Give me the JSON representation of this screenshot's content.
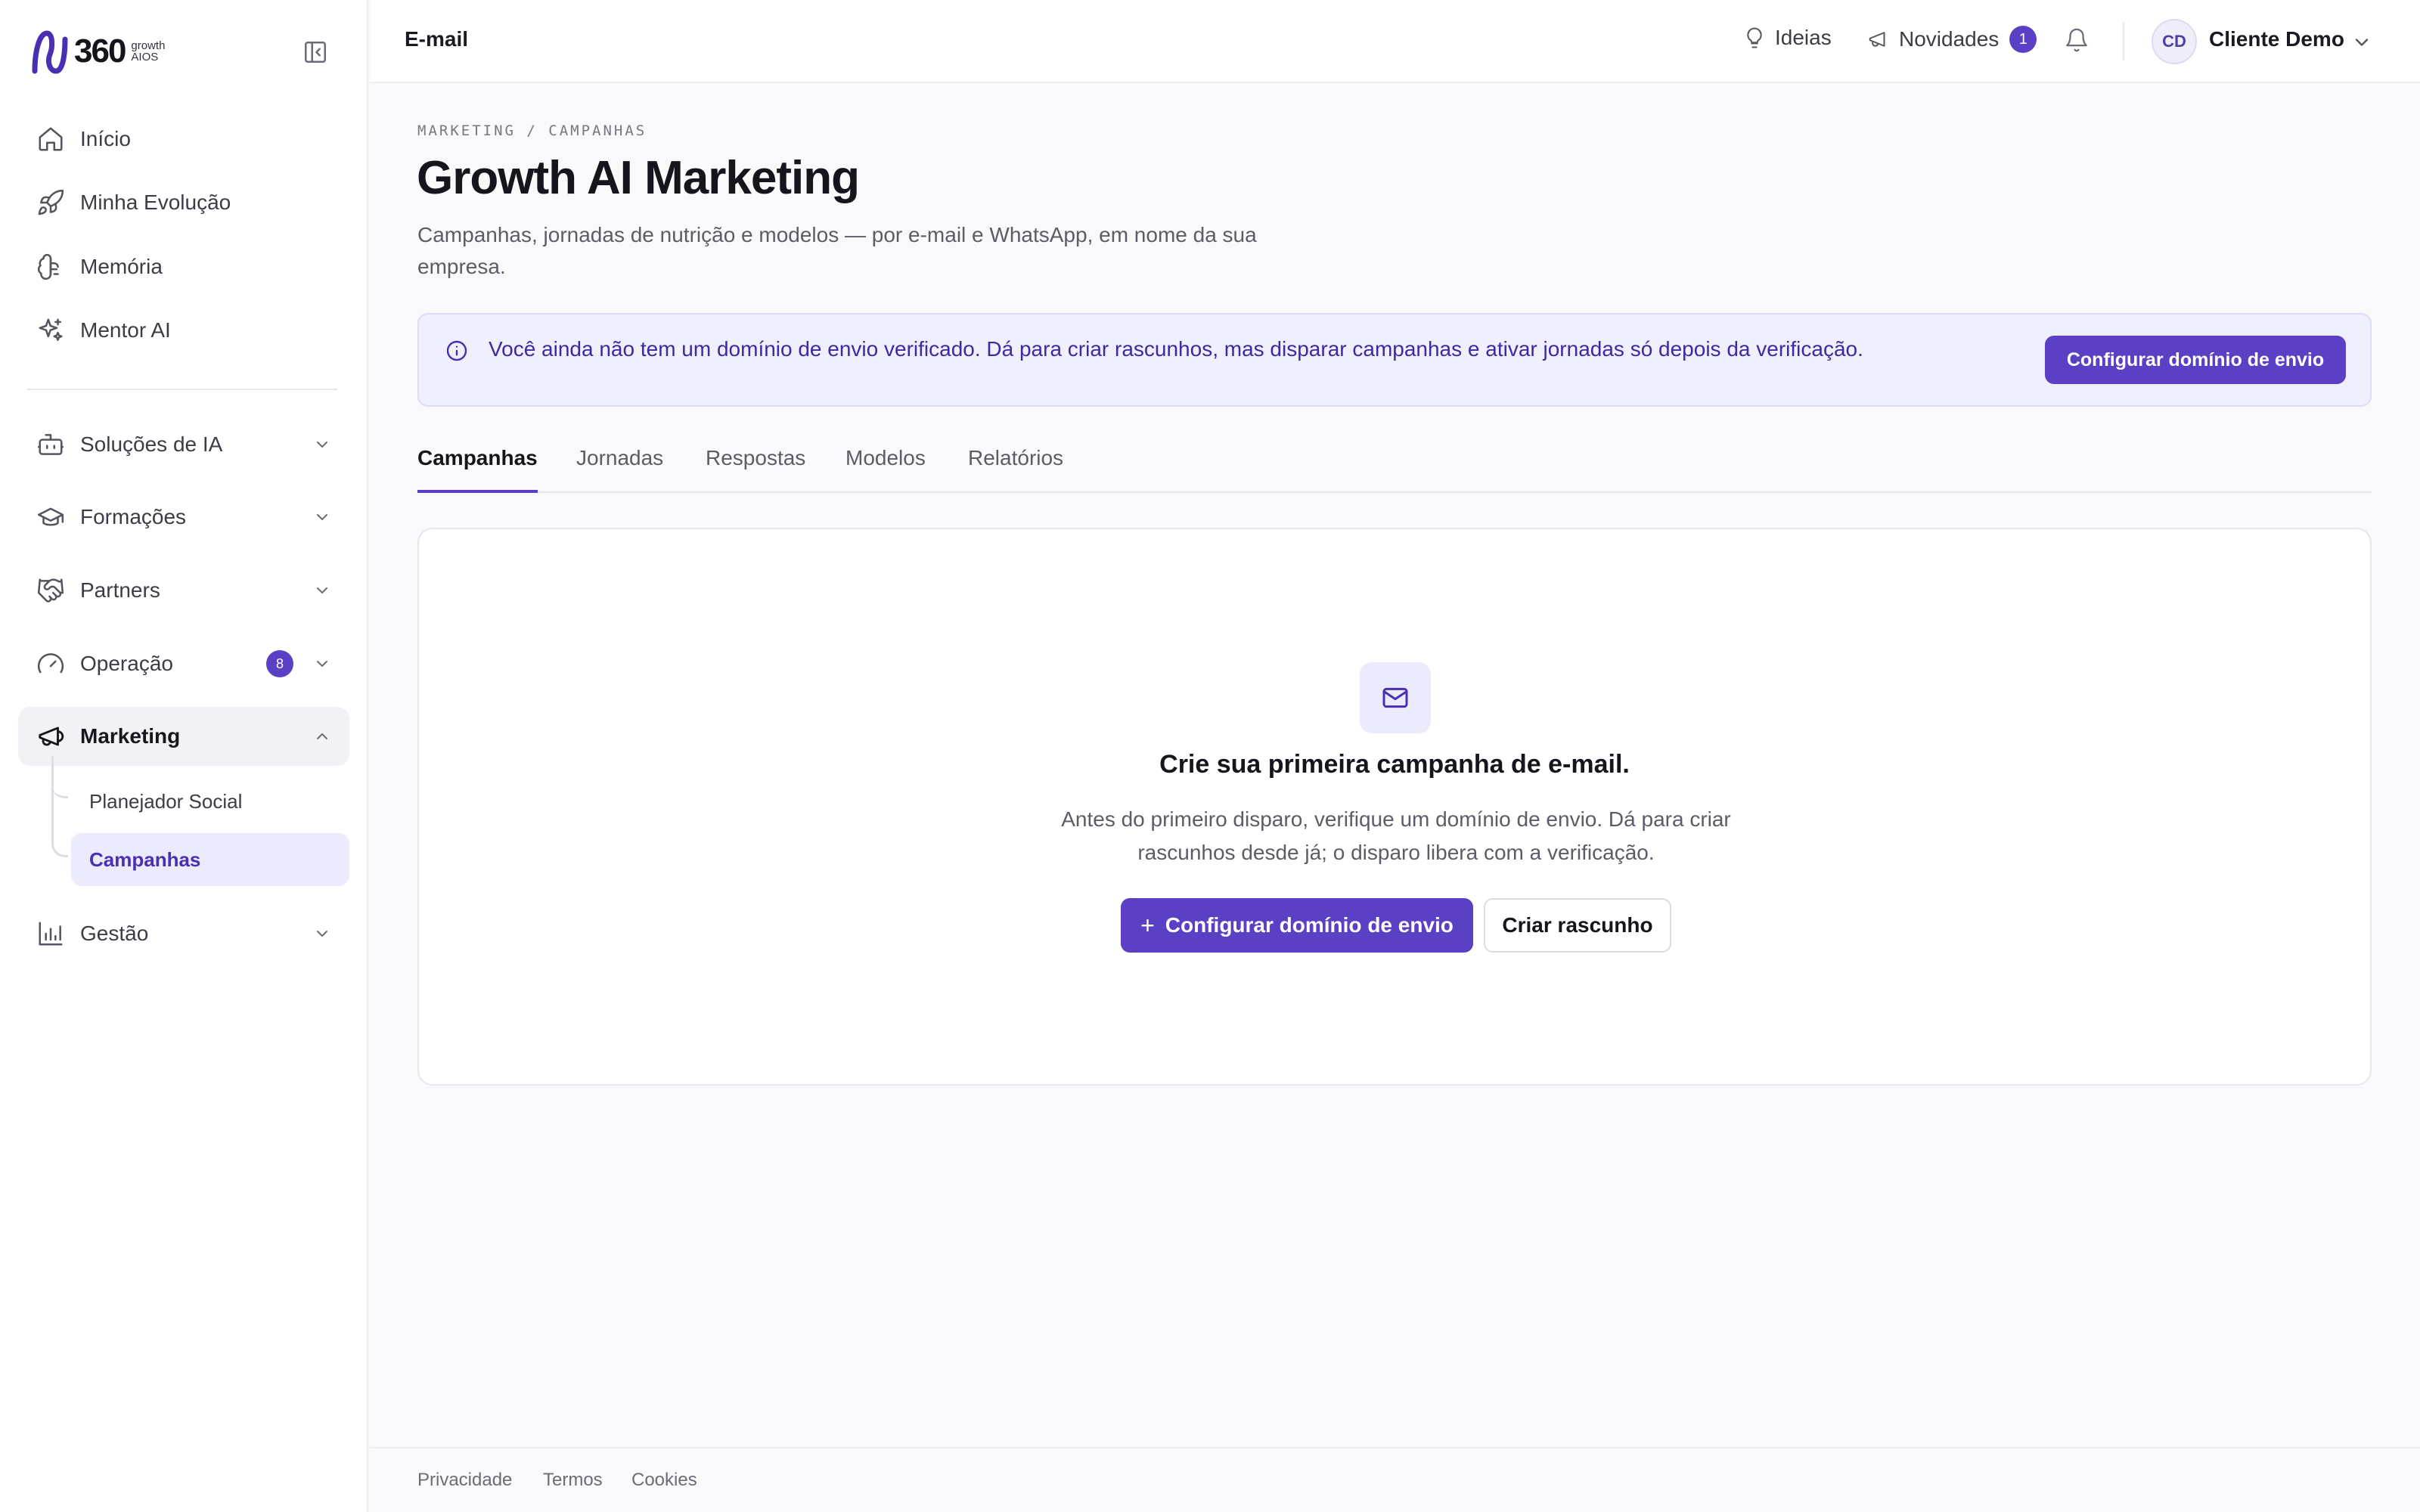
{
  "brand": {
    "logo_number": "360",
    "logo_line1": "growth",
    "logo_line2": "AIOS",
    "accent_color": "#5b3fc4"
  },
  "sidebar": {
    "primary": [
      {
        "label": "Início",
        "icon": "home-icon"
      },
      {
        "label": "Minha Evolução",
        "icon": "rocket-icon"
      },
      {
        "label": "Memória",
        "icon": "brain-icon"
      },
      {
        "label": "Mentor AI",
        "icon": "sparkles-icon"
      }
    ],
    "groups": [
      {
        "label": "Soluções de IA",
        "icon": "bot-icon"
      },
      {
        "label": "Formações",
        "icon": "graduation-cap-icon"
      },
      {
        "label": "Partners",
        "icon": "handshake-icon"
      },
      {
        "label": "Operação",
        "icon": "gauge-icon",
        "badge": "8"
      },
      {
        "label": "Marketing",
        "icon": "megaphone-icon",
        "expanded": true
      },
      {
        "label": "Gestão",
        "icon": "bar-chart-icon"
      }
    ],
    "marketing_children": [
      {
        "label": "Planejador Social"
      },
      {
        "label": "Campanhas",
        "active": true
      }
    ]
  },
  "topbar": {
    "title": "E-mail",
    "ideas_label": "Ideias",
    "news_label": "Novidades",
    "news_badge": "1",
    "user_initials": "CD",
    "user_name": "Cliente Demo"
  },
  "page": {
    "breadcrumb": "MARKETING / CAMPANHAS",
    "title": "Growth AI Marketing",
    "description": "Campanhas, jornadas de nutrição e modelos — por e-mail e WhatsApp, em nome da sua empresa."
  },
  "alert": {
    "text": "Você ainda não tem um domínio de envio verificado. Dá para criar rascunhos, mas disparar campanhas e ativar jornadas só depois da verificação.",
    "button_label": "Configurar domínio de envio"
  },
  "tabs": [
    {
      "label": "Campanhas",
      "active": true
    },
    {
      "label": "Jornadas"
    },
    {
      "label": "Respostas"
    },
    {
      "label": "Modelos"
    },
    {
      "label": "Relatórios"
    }
  ],
  "empty_state": {
    "icon": "mail-icon",
    "title": "Crie sua primeira campanha de e-mail.",
    "description": "Antes do primeiro disparo, verifique um domínio de envio. Dá para criar rascunhos desde já; o disparo libera com a verificação.",
    "primary_button": "Configurar domínio de envio",
    "secondary_button": "Criar rascunho"
  },
  "footer": {
    "links": [
      "Privacidade",
      "Termos",
      "Cookies"
    ]
  }
}
